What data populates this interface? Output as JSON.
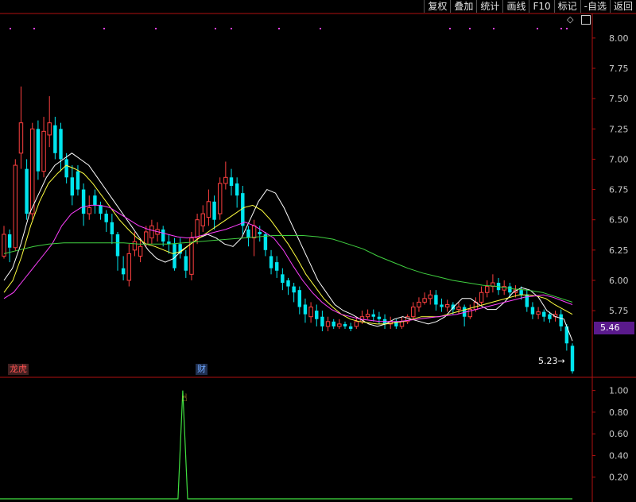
{
  "toolbar": {
    "buttons": [
      "复权",
      "叠加",
      "统计",
      "画线",
      "F10",
      "标记",
      "-自选",
      "返回"
    ]
  },
  "tags": {
    "longhu": "龙虎",
    "cai": "财"
  },
  "price_box": "5.46",
  "low_label": "5.23→",
  "icons": {
    "diamond": "◇",
    "hand": "☝"
  },
  "colors": {
    "up": "#ff4040",
    "down": "#00e5ee",
    "ma5": "#ffffff",
    "ma10": "#ffff40",
    "ma20": "#ff40ff",
    "ma60": "#40d040",
    "indicator": "#40e040",
    "axis": "#b01010"
  },
  "chart_data": [
    {
      "type": "candlestick",
      "title": "",
      "y_ticks": [
        "8.00",
        "7.75",
        "7.50",
        "7.25",
        "7.00",
        "6.75",
        "6.50",
        "6.25",
        "6.00",
        "5.75"
      ],
      "ylim": [
        5.2,
        8.15
      ],
      "candles": [
        [
          6.2,
          6.38,
          6.45,
          6.18
        ],
        [
          6.38,
          6.27,
          6.42,
          6.15
        ],
        [
          6.27,
          6.95,
          7.0,
          6.24
        ],
        [
          7.05,
          7.3,
          7.6,
          6.92
        ],
        [
          6.92,
          6.55,
          7.0,
          6.5
        ],
        [
          6.55,
          7.25,
          7.3,
          6.5
        ],
        [
          7.25,
          6.9,
          7.32,
          6.83
        ],
        [
          6.9,
          7.23,
          7.35,
          6.85
        ],
        [
          7.2,
          7.3,
          7.52,
          7.1
        ],
        [
          7.28,
          7.05,
          7.35,
          7.0
        ],
        [
          7.25,
          7.0,
          7.3,
          6.9
        ],
        [
          7.0,
          6.85,
          7.05,
          6.8
        ],
        [
          6.85,
          6.7,
          6.95,
          6.62
        ],
        [
          6.9,
          6.75,
          6.95,
          6.7
        ],
        [
          6.75,
          6.55,
          6.8,
          6.45
        ],
        [
          6.55,
          6.6,
          6.7,
          6.5
        ],
        [
          6.7,
          6.62,
          6.75,
          6.55
        ],
        [
          6.62,
          6.55,
          6.65,
          6.5
        ],
        [
          6.55,
          6.48,
          6.58,
          6.4
        ],
        [
          6.48,
          6.38,
          6.55,
          6.3
        ],
        [
          6.38,
          6.2,
          6.4,
          6.08
        ],
        [
          6.1,
          6.05,
          6.2,
          6.0
        ],
        [
          6.0,
          6.22,
          6.3,
          5.95
        ],
        [
          6.25,
          6.32,
          6.4,
          6.2
        ],
        [
          6.2,
          6.28,
          6.35,
          6.15
        ],
        [
          6.3,
          6.4,
          6.45,
          6.28
        ],
        [
          6.35,
          6.45,
          6.5,
          6.3
        ],
        [
          6.38,
          6.42,
          6.48,
          6.32
        ],
        [
          6.42,
          6.32,
          6.45,
          6.28
        ],
        [
          6.32,
          6.3,
          6.38,
          6.22
        ],
        [
          6.3,
          6.1,
          6.35,
          6.08
        ],
        [
          6.3,
          6.22,
          6.35,
          6.18
        ],
        [
          6.2,
          6.08,
          6.25,
          6.02
        ],
        [
          6.05,
          6.35,
          6.4,
          6.0
        ],
        [
          6.35,
          6.5,
          6.55,
          6.3
        ],
        [
          6.45,
          6.55,
          6.62,
          6.4
        ],
        [
          6.52,
          6.65,
          6.75,
          6.45
        ],
        [
          6.65,
          6.5,
          6.7,
          6.42
        ],
        [
          6.55,
          6.8,
          6.85,
          6.5
        ],
        [
          6.8,
          6.85,
          6.98,
          6.75
        ],
        [
          6.85,
          6.78,
          6.92,
          6.7
        ],
        [
          6.8,
          6.7,
          6.85,
          6.6
        ],
        [
          6.72,
          6.45,
          6.78,
          6.38
        ],
        [
          6.42,
          6.35,
          6.45,
          6.28
        ],
        [
          6.35,
          6.45,
          6.5,
          6.2
        ],
        [
          6.4,
          6.38,
          6.45,
          6.32
        ],
        [
          6.38,
          6.25,
          6.4,
          6.2
        ],
        [
          6.2,
          6.1,
          6.25,
          6.05
        ],
        [
          6.15,
          6.08,
          6.2,
          6.02
        ],
        [
          6.05,
          5.98,
          6.1,
          5.92
        ],
        [
          6.0,
          5.95,
          6.02,
          5.88
        ],
        [
          5.95,
          5.9,
          5.98,
          5.82
        ],
        [
          5.92,
          5.78,
          5.95,
          5.72
        ],
        [
          5.8,
          5.72,
          5.85,
          5.65
        ],
        [
          5.7,
          5.78,
          5.82,
          5.65
        ],
        [
          5.75,
          5.68,
          5.8,
          5.62
        ],
        [
          5.7,
          5.62,
          5.75,
          5.58
        ],
        [
          5.62,
          5.66,
          5.7,
          5.58
        ],
        [
          5.66,
          5.62,
          5.68,
          5.6
        ],
        [
          5.62,
          5.64,
          5.68,
          5.6
        ],
        [
          5.64,
          5.62,
          5.66,
          5.6
        ],
        [
          5.62,
          5.6,
          5.65,
          5.58
        ],
        [
          5.62,
          5.66,
          5.7,
          5.6
        ],
        [
          5.66,
          5.7,
          5.75,
          5.64
        ],
        [
          5.7,
          5.72,
          5.76,
          5.68
        ],
        [
          5.72,
          5.7,
          5.76,
          5.66
        ],
        [
          5.7,
          5.68,
          5.74,
          5.64
        ],
        [
          5.68,
          5.64,
          5.72,
          5.6
        ],
        [
          5.64,
          5.66,
          5.7,
          5.6
        ],
        [
          5.66,
          5.62,
          5.68,
          5.6
        ],
        [
          5.62,
          5.66,
          5.7,
          5.6
        ],
        [
          5.66,
          5.7,
          5.72,
          5.64
        ],
        [
          5.7,
          5.78,
          5.82,
          5.68
        ],
        [
          5.78,
          5.82,
          5.86,
          5.74
        ],
        [
          5.82,
          5.85,
          5.9,
          5.8
        ],
        [
          5.85,
          5.88,
          5.92,
          5.8
        ],
        [
          5.88,
          5.8,
          5.92,
          5.75
        ],
        [
          5.8,
          5.78,
          5.85,
          5.74
        ],
        [
          5.78,
          5.8,
          5.84,
          5.74
        ],
        [
          5.8,
          5.76,
          5.82,
          5.72
        ],
        [
          5.76,
          5.78,
          5.82,
          5.72
        ],
        [
          5.78,
          5.7,
          5.8,
          5.62
        ],
        [
          5.7,
          5.76,
          5.8,
          5.68
        ],
        [
          5.76,
          5.82,
          5.86,
          5.74
        ],
        [
          5.82,
          5.9,
          5.95,
          5.8
        ],
        [
          5.9,
          5.95,
          6.0,
          5.86
        ],
        [
          5.95,
          5.98,
          6.05,
          5.9
        ],
        [
          5.98,
          5.92,
          6.02,
          5.88
        ],
        [
          5.92,
          5.95,
          6.0,
          5.88
        ],
        [
          5.95,
          5.9,
          5.98,
          5.86
        ],
        [
          5.9,
          5.92,
          5.96,
          5.86
        ],
        [
          5.92,
          5.88,
          5.95,
          5.84
        ],
        [
          5.88,
          5.78,
          5.92,
          5.74
        ],
        [
          5.78,
          5.72,
          5.82,
          5.68
        ],
        [
          5.72,
          5.74,
          5.78,
          5.68
        ],
        [
          5.74,
          5.7,
          5.76,
          5.66
        ],
        [
          5.72,
          5.68,
          5.74,
          5.65
        ],
        [
          5.7,
          5.72,
          5.75,
          5.66
        ],
        [
          5.72,
          5.62,
          5.76,
          5.58
        ],
        [
          5.62,
          5.48,
          5.64,
          5.42
        ],
        [
          5.46,
          5.25,
          5.48,
          5.23
        ]
      ],
      "ma_series": [
        {
          "values": [
            6.0,
            6.1,
            6.3,
            6.55,
            6.7,
            6.85,
            6.95,
            7.0,
            7.05,
            7.0,
            6.95,
            6.85,
            6.75,
            6.65,
            6.55,
            6.45,
            6.35,
            6.25,
            6.18,
            6.15,
            6.18,
            6.25,
            6.3,
            6.35,
            6.38,
            6.35,
            6.3,
            6.28,
            6.35,
            6.5,
            6.65,
            6.75,
            6.72,
            6.6,
            6.45,
            6.3,
            6.15,
            6.0,
            5.9,
            5.8,
            5.75,
            5.72,
            5.68,
            5.64,
            5.62,
            5.64,
            5.68,
            5.7,
            5.68,
            5.66,
            5.64,
            5.66,
            5.7,
            5.78,
            5.85,
            5.85,
            5.8,
            5.76,
            5.76,
            5.82,
            5.9,
            5.94,
            5.92,
            5.86,
            5.75,
            5.7,
            5.68,
            5.5
          ]
        },
        {
          "values": [
            5.9,
            6.0,
            6.2,
            6.45,
            6.65,
            6.8,
            6.88,
            6.95,
            6.92,
            6.88,
            6.8,
            6.7,
            6.6,
            6.5,
            6.42,
            6.35,
            6.3,
            6.28,
            6.25,
            6.22,
            6.24,
            6.3,
            6.35,
            6.4,
            6.45,
            6.5,
            6.55,
            6.6,
            6.62,
            6.58,
            6.5,
            6.4,
            6.3,
            6.18,
            6.05,
            5.95,
            5.85,
            5.78,
            5.72,
            5.68,
            5.66,
            5.65,
            5.64,
            5.64,
            5.65,
            5.66,
            5.68,
            5.7,
            5.7,
            5.7,
            5.72,
            5.74,
            5.76,
            5.78,
            5.8,
            5.82,
            5.84,
            5.86,
            5.88,
            5.88,
            5.87,
            5.85,
            5.8,
            5.76,
            5.72
          ]
        },
        {
          "values": [
            5.85,
            5.9,
            6.0,
            6.1,
            6.2,
            6.3,
            6.45,
            6.55,
            6.6,
            6.62,
            6.62,
            6.6,
            6.55,
            6.5,
            6.45,
            6.42,
            6.4,
            6.38,
            6.36,
            6.35,
            6.36,
            6.38,
            6.4,
            6.42,
            6.45,
            6.48,
            6.45,
            6.4,
            6.35,
            6.25,
            6.12,
            6.0,
            5.9,
            5.82,
            5.76,
            5.72,
            5.7,
            5.68,
            5.67,
            5.66,
            5.66,
            5.66,
            5.67,
            5.68,
            5.69,
            5.7,
            5.71,
            5.72,
            5.74,
            5.76,
            5.78,
            5.8,
            5.82,
            5.84,
            5.86,
            5.87,
            5.88,
            5.86,
            5.83,
            5.8
          ]
        },
        {
          "values": [
            6.22,
            6.25,
            6.28,
            6.3,
            6.31,
            6.31,
            6.31,
            6.31,
            6.31,
            6.3,
            6.3,
            6.3,
            6.31,
            6.32,
            6.33,
            6.34,
            6.35,
            6.36,
            6.37,
            6.37,
            6.37,
            6.36,
            6.34,
            6.3,
            6.26,
            6.2,
            6.15,
            6.1,
            6.06,
            6.03,
            6.0,
            5.98,
            5.96,
            5.95,
            5.93,
            5.92,
            5.9,
            5.86,
            5.82
          ]
        }
      ]
    },
    {
      "type": "line",
      "title": "",
      "y_ticks": [
        "1.00",
        "0.80",
        "0.60",
        "0.40",
        "0.20"
      ],
      "ylim": [
        0,
        1.1
      ],
      "values": [
        0,
        0,
        0,
        0,
        0,
        0,
        0,
        0,
        0,
        0,
        0,
        0,
        0,
        0,
        0,
        0,
        0,
        0,
        0,
        0,
        0,
        0,
        0,
        0,
        0,
        0,
        0,
        0,
        0,
        0,
        0,
        0,
        0,
        0,
        0,
        0,
        0,
        0,
        1,
        0,
        0,
        0,
        0,
        0,
        0,
        0,
        0,
        0,
        0,
        0,
        0,
        0,
        0,
        0,
        0,
        0,
        0,
        0,
        0,
        0,
        0,
        0,
        0,
        0,
        0,
        0,
        0,
        0,
        0,
        0,
        0,
        0,
        0,
        0,
        0,
        0,
        0,
        0,
        0,
        0,
        0,
        0,
        0,
        0,
        0,
        0,
        0,
        0,
        0,
        0,
        0,
        0,
        0,
        0,
        0,
        0,
        0,
        0,
        0,
        0,
        0,
        0,
        0,
        0,
        0,
        0,
        0,
        0,
        0,
        0,
        0,
        0,
        0,
        0,
        0,
        0,
        0,
        0,
        0,
        0
      ]
    }
  ],
  "dots": {
    "count": 10
  }
}
